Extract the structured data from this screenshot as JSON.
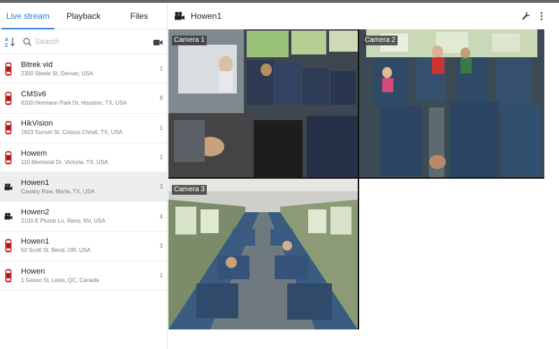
{
  "tabs": [
    {
      "label": "Live stream"
    },
    {
      "label": "Playback"
    },
    {
      "label": "Files"
    }
  ],
  "search": {
    "placeholder": "Search"
  },
  "devices": [
    {
      "name": "Bitrek vid",
      "address": "2300 Steele St, Denver, USA",
      "count": "1",
      "icon": "bus-icon"
    },
    {
      "name": "CMSv6",
      "address": "6200 Hermann Park Dr, Houston, TX, USA",
      "count": "8",
      "icon": "bus-icon"
    },
    {
      "name": "HikVision",
      "address": "1623 Sunset St, Corpus Christi, TX, USA",
      "count": "1",
      "icon": "bus-icon"
    },
    {
      "name": "Howem",
      "address": "110 Memorial Dr, Victoria, TX, USA",
      "count": "1",
      "icon": "bus-icon"
    },
    {
      "name": "Howen1",
      "address": "Cavalry Row, Marfa, TX, USA",
      "count": "3",
      "icon": "camera-icon"
    },
    {
      "name": "Howen2",
      "address": "2100 E Plumb Ln, Reno, NV, USA",
      "count": "4",
      "icon": "camera-icon"
    },
    {
      "name": "Howen1",
      "address": "50 Scott St, Bend, OR, USA",
      "count": "3",
      "icon": "bus-icon"
    },
    {
      "name": "Howen",
      "address": "1 Gasso St, Levis, QC, Canada",
      "count": "1",
      "icon": "bus-icon"
    }
  ],
  "main": {
    "title": "Howen1",
    "cameras": [
      {
        "label": "Camera 1"
      },
      {
        "label": "Camera 2"
      },
      {
        "label": "Camera 3"
      }
    ]
  },
  "colors": {
    "accent": "#2a7ad6",
    "vehicle": "#c62828",
    "seat": "#2f4a66"
  }
}
